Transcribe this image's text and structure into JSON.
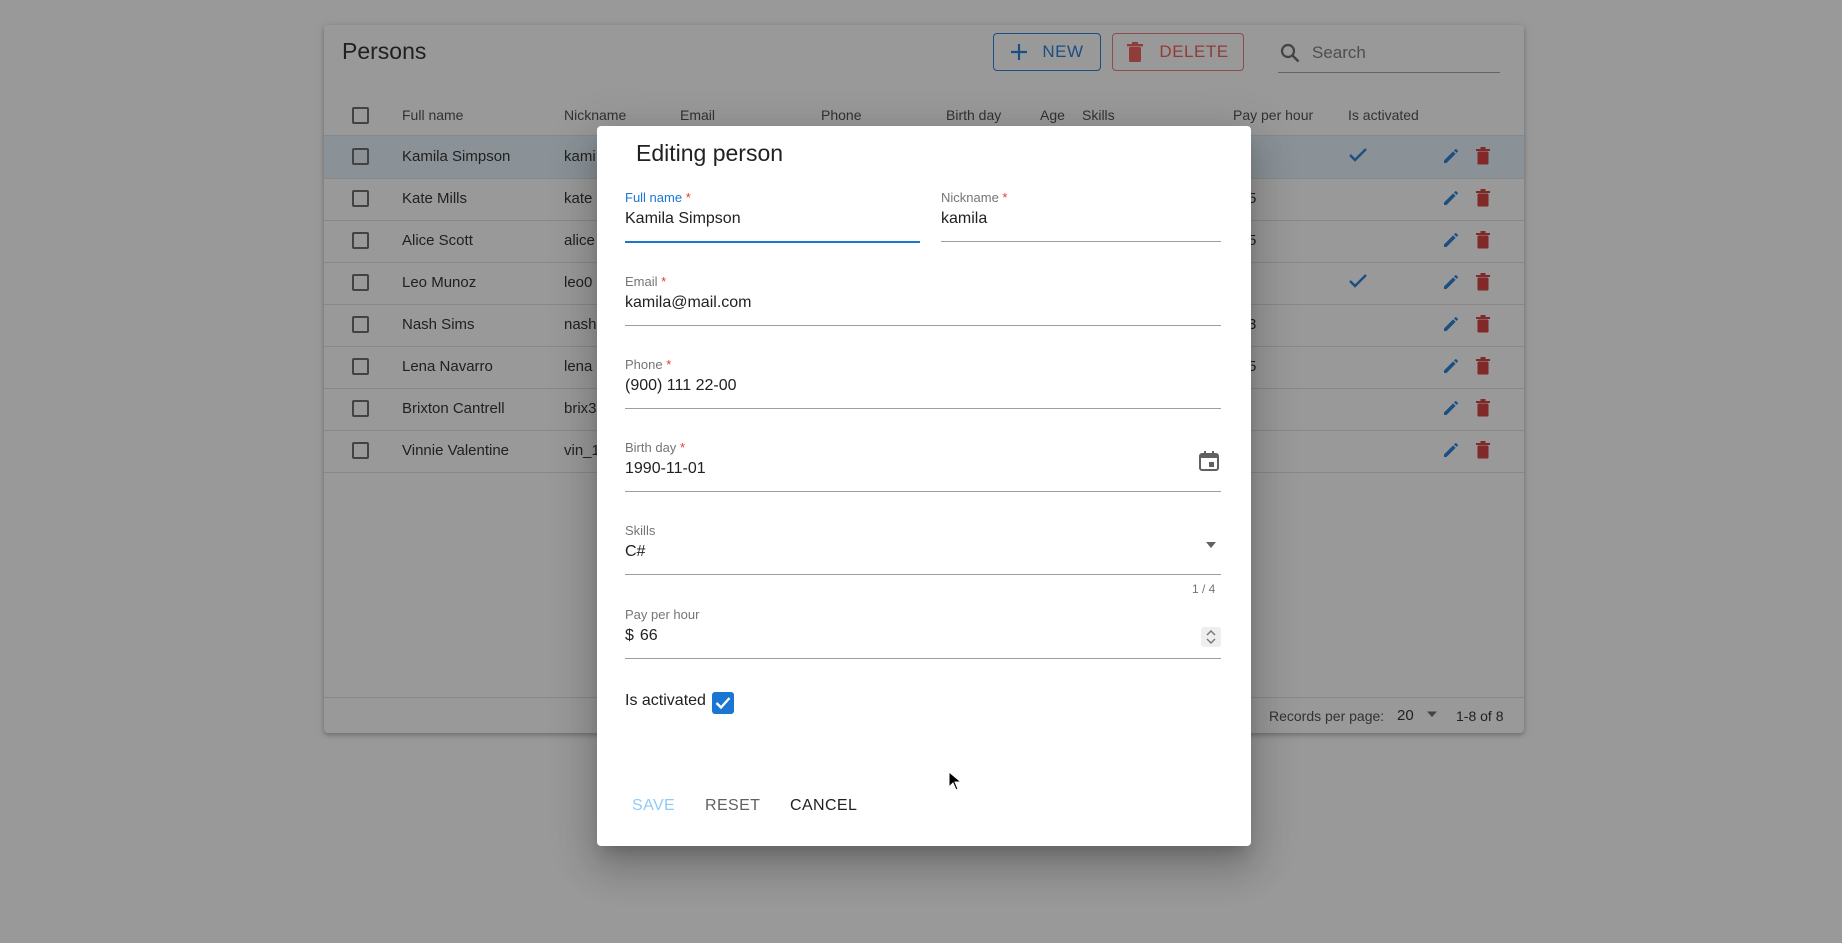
{
  "persons": {
    "title": "Persons",
    "new_label": "NEW",
    "delete_label": "DELETE",
    "search_placeholder": "Search",
    "columns": [
      "Full name",
      "Nickname",
      "Email",
      "Phone",
      "Birth day",
      "Age",
      "Skills",
      "Pay per hour",
      "Is activated"
    ],
    "rows": [
      {
        "full_name": "Kamila Simpson",
        "nickname": "kami",
        "pay": "",
        "activated": true,
        "selected": true
      },
      {
        "full_name": "Kate Mills",
        "nickname": "kate",
        "pay": "5",
        "activated": false,
        "selected": false
      },
      {
        "full_name": "Alice Scott",
        "nickname": "alice",
        "pay": "5",
        "activated": false,
        "selected": false
      },
      {
        "full_name": "Leo Munoz",
        "nickname": "leo0",
        "pay": "",
        "activated": true,
        "selected": false
      },
      {
        "full_name": "Nash Sims",
        "nickname": "nash",
        "pay": "3",
        "activated": false,
        "selected": false
      },
      {
        "full_name": "Lena Navarro",
        "nickname": "lena",
        "pay": "5",
        "activated": false,
        "selected": false
      },
      {
        "full_name": "Brixton Cantrell",
        "nickname": "brix3",
        "pay": "",
        "activated": false,
        "selected": false
      },
      {
        "full_name": "Vinnie Valentine",
        "nickname": "vin_1",
        "pay": "",
        "activated": false,
        "selected": false
      }
    ],
    "footer": {
      "records_per_page_label": "Records per page:",
      "records_per_page_value": "20",
      "range": "1-8 of 8"
    }
  },
  "dialog": {
    "title": "Editing person",
    "required_mark": "*",
    "fields": {
      "full_name": {
        "label": "Full name",
        "value": "Kamila Simpson"
      },
      "nickname": {
        "label": "Nickname",
        "value": "kamila"
      },
      "email": {
        "label": "Email",
        "value": "kamila@mail.com"
      },
      "phone": {
        "label": "Phone",
        "value": "(900) 111 22-00"
      },
      "birth_day": {
        "label": "Birth day",
        "value": "1990-11-01"
      },
      "skills": {
        "label": "Skills",
        "value": "C#",
        "counter": "1 / 4"
      },
      "pay_per_hour": {
        "label": "Pay per hour",
        "prefix": "$",
        "value": "66"
      }
    },
    "is_activated": {
      "label": "Is activated",
      "checked": true
    },
    "buttons": {
      "save": "SAVE",
      "reset": "RESET",
      "cancel": "CANCEL"
    }
  },
  "colors": {
    "primary": "#1976d2",
    "danger": "#d32f2f",
    "selected_row": "#e3f2fd",
    "scrim": "rgba(33,33,33,0.46)"
  }
}
